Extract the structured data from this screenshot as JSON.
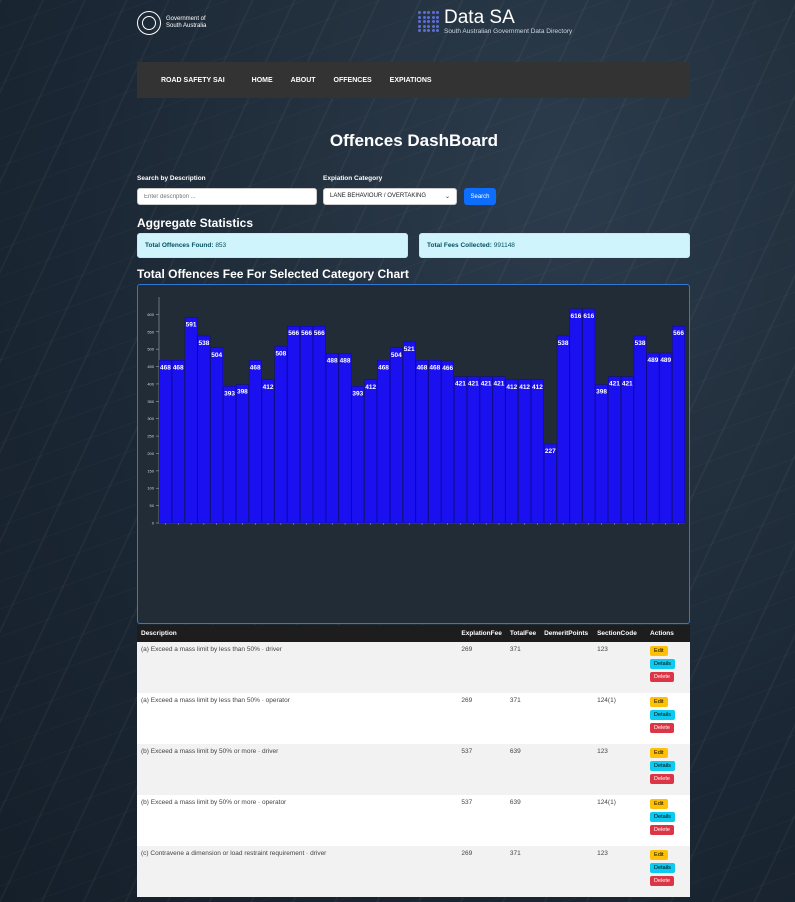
{
  "header": {
    "gov_line1": "Government of",
    "gov_line2": "South Australia",
    "brand_title": "Data SA",
    "brand_subtitle": "South Australian Government Data Directory"
  },
  "nav": {
    "brand": "ROAD SAFETY SAI",
    "items": [
      "HOME",
      "ABOUT",
      "OFFENCES",
      "EXPIATIONS"
    ]
  },
  "page_title": "Offences DashBoard",
  "filters": {
    "search_label": "Search by Description",
    "search_placeholder": "Enter description ...",
    "category_label": "Expiation Category",
    "category_value": "LANE BEHAVIOUR / OVERTAKING",
    "search_button": "Search"
  },
  "aggregate": {
    "heading": "Aggregate Statistics",
    "offences_label": "Total Offences Found:",
    "offences_value": "853",
    "fees_label": "Total Fees Collected:",
    "fees_value": "991148"
  },
  "chart_heading": "Total Offences Fee For Selected Category Chart",
  "chart_data": {
    "type": "bar",
    "title": "",
    "xlabel": "",
    "ylabel": "",
    "ylim": [
      0,
      650
    ],
    "yticks": [
      0,
      50,
      100,
      150,
      200,
      250,
      300,
      350,
      400,
      450,
      500,
      550,
      600
    ],
    "color": "#1a10f0",
    "values": [
      468,
      468,
      591,
      538,
      504,
      393,
      398,
      468,
      412,
      508,
      566,
      566,
      566,
      488,
      488,
      393,
      412,
      468,
      504,
      521,
      468,
      468,
      466,
      421,
      421,
      421,
      421,
      412,
      412,
      412,
      227,
      538,
      616,
      616,
      398,
      421,
      421,
      538,
      489,
      489,
      566
    ]
  },
  "table": {
    "headers": [
      "Description",
      "ExplationFee",
      "TotalFee",
      "DemeritPoints",
      "SectionCode",
      "Actions"
    ],
    "rows": [
      {
        "description": "(a) Exceed a mass limit by less than 50%",
        "role": "driver",
        "explation_fee": "269",
        "total_fee": "371",
        "demerit": "",
        "section": "123"
      },
      {
        "description": "(a) Exceed a mass limit by less than 50%",
        "role": "operator",
        "explation_fee": "269",
        "total_fee": "371",
        "demerit": "",
        "section": "124(1)"
      },
      {
        "description": "(b) Exceed a mass limit by 50% or more",
        "role": "driver",
        "explation_fee": "537",
        "total_fee": "639",
        "demerit": "",
        "section": "123"
      },
      {
        "description": "(b) Exceed a mass limit by 50% or more",
        "role": "operator",
        "explation_fee": "537",
        "total_fee": "639",
        "demerit": "",
        "section": "124(1)"
      },
      {
        "description": "(c) Contravene a dimension or load restraint requirement",
        "role": "driver",
        "explation_fee": "269",
        "total_fee": "371",
        "demerit": "",
        "section": "123"
      }
    ],
    "separator": " - ",
    "actions": {
      "edit": "Edit",
      "details": "Details",
      "delete": "Delete"
    }
  }
}
